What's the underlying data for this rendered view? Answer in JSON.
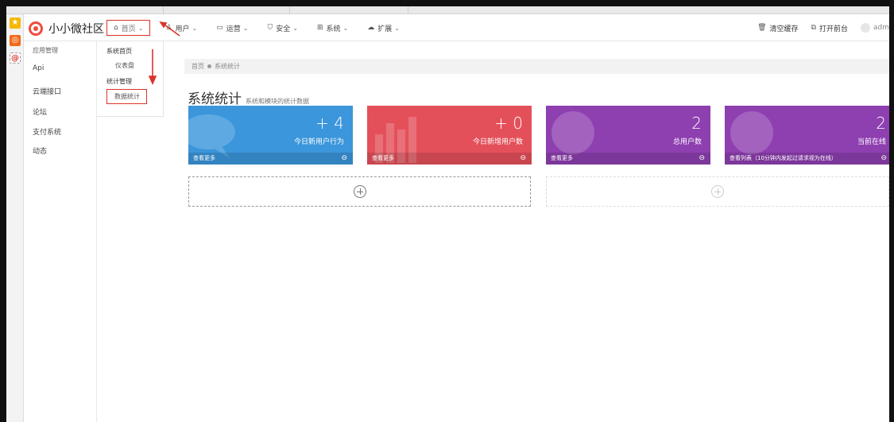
{
  "brand": {
    "name": "小小微社区",
    "accent": "#f04c3e"
  },
  "nav": [
    {
      "label": "首页",
      "icon": "home-icon",
      "active": true
    },
    {
      "label": "用户",
      "icon": "user-icon"
    },
    {
      "label": "运营",
      "icon": "monitor-icon"
    },
    {
      "label": "安全",
      "icon": "shield-icon"
    },
    {
      "label": "系统",
      "icon": "windows-icon"
    },
    {
      "label": "扩展",
      "icon": "cloud-icon"
    }
  ],
  "top_right": {
    "clear_cache": "清空缓存",
    "open_frontend": "打开前台",
    "user": "adm"
  },
  "sidebar1": {
    "head": "应用管理",
    "items": [
      "Api",
      "云端接口",
      "论坛",
      "支付系统",
      "动态"
    ]
  },
  "sidebar2": {
    "group1": "系统首页",
    "item1": "仪表盘",
    "group2": "统计管理",
    "item2": "数据统计"
  },
  "breadcrumb": {
    "home": "首页",
    "current": "系统统计"
  },
  "page": {
    "title": "系统统计",
    "subtitle": "系统和模块的统计数据"
  },
  "cards": [
    {
      "value": "+ 4",
      "label": "今日新用户行为",
      "footer": "查看更多",
      "color": "#3b96db"
    },
    {
      "value": "+ 0",
      "label": "今日新增用户数",
      "footer": "查看更多",
      "color": "#e4505a"
    },
    {
      "value": "2",
      "label": "总用户数",
      "footer": "查看更多",
      "color": "#8e3fb0"
    },
    {
      "value": "2",
      "label": "当前在线",
      "footer": "查看列表（10分钟内发起过请求视为在线）",
      "color": "#8e3fb0"
    }
  ],
  "annotation_color": "#d9342b"
}
